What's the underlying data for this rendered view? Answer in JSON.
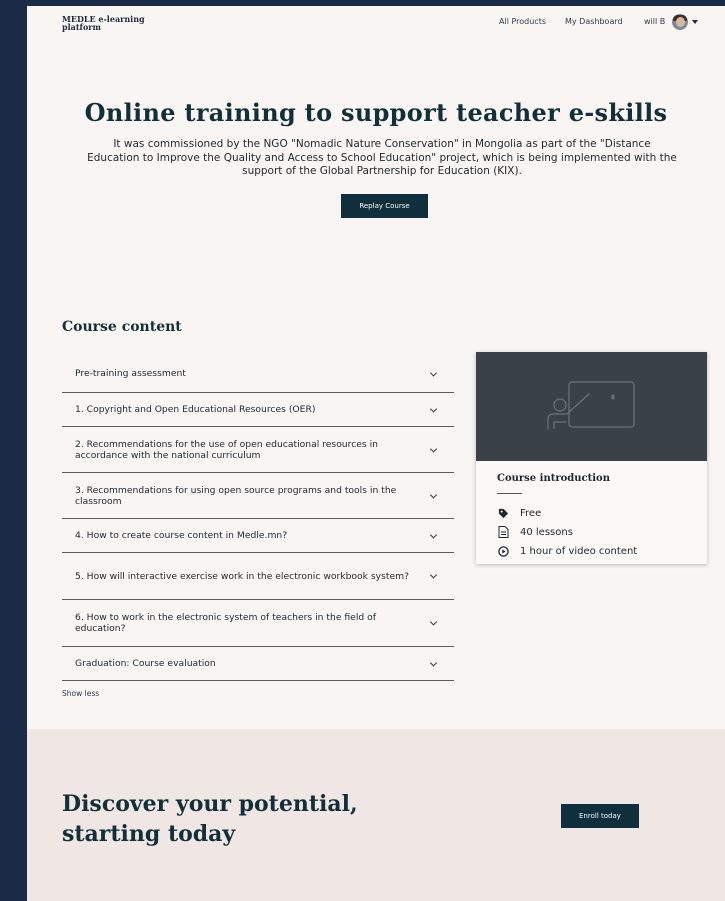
{
  "nav": {
    "logo": "MEDLE e-learning platform",
    "links": [
      "All Products",
      "My Dashboard"
    ],
    "user": "will B"
  },
  "hero": {
    "title": "Online training to support teacher e-skills",
    "subtitle": "It was commissioned by the NGO \"Nomadic Nature Conservation\" in Mongolia as part of the \"Distance Education to Improve the Quality and Access to School Education\" project, which is being implemented with the support of the Global Partnership for Education (KIX).",
    "button": "Replay Course"
  },
  "course_content": {
    "title": "Course content",
    "sections": [
      "Pre-training assessment",
      "1. Copyright and Open Educational Resources (OER)",
      "2. Recommendations for the use of open educational resources in accordance with the national curriculum",
      "3. Recommendations for using open source programs and tools in the classroom",
      "4. How to create course content in Medle.mn?",
      "5. How will interactive exercise work in the electronic workbook system?",
      "6. How to work in the electronic system of teachers in the field of education?",
      "Graduation: Course evaluation"
    ],
    "show_less": "Show less"
  },
  "card": {
    "title": "Course introduction",
    "items": [
      {
        "icon": "tag-icon",
        "text": "Free"
      },
      {
        "icon": "document-icon",
        "text": "40 lessons"
      },
      {
        "icon": "play-circle-icon",
        "text": "1 hour of video content"
      }
    ]
  },
  "footer": {
    "title": "Discover your potential, starting today",
    "button": "Enroll today"
  },
  "colors": {
    "page_bg": "#f9f5f3",
    "outer_bg": "#1b2a45",
    "button_bg": "#0f2f3c",
    "footer_bg": "#f0e7e4",
    "card_image_bg": "#394249"
  }
}
